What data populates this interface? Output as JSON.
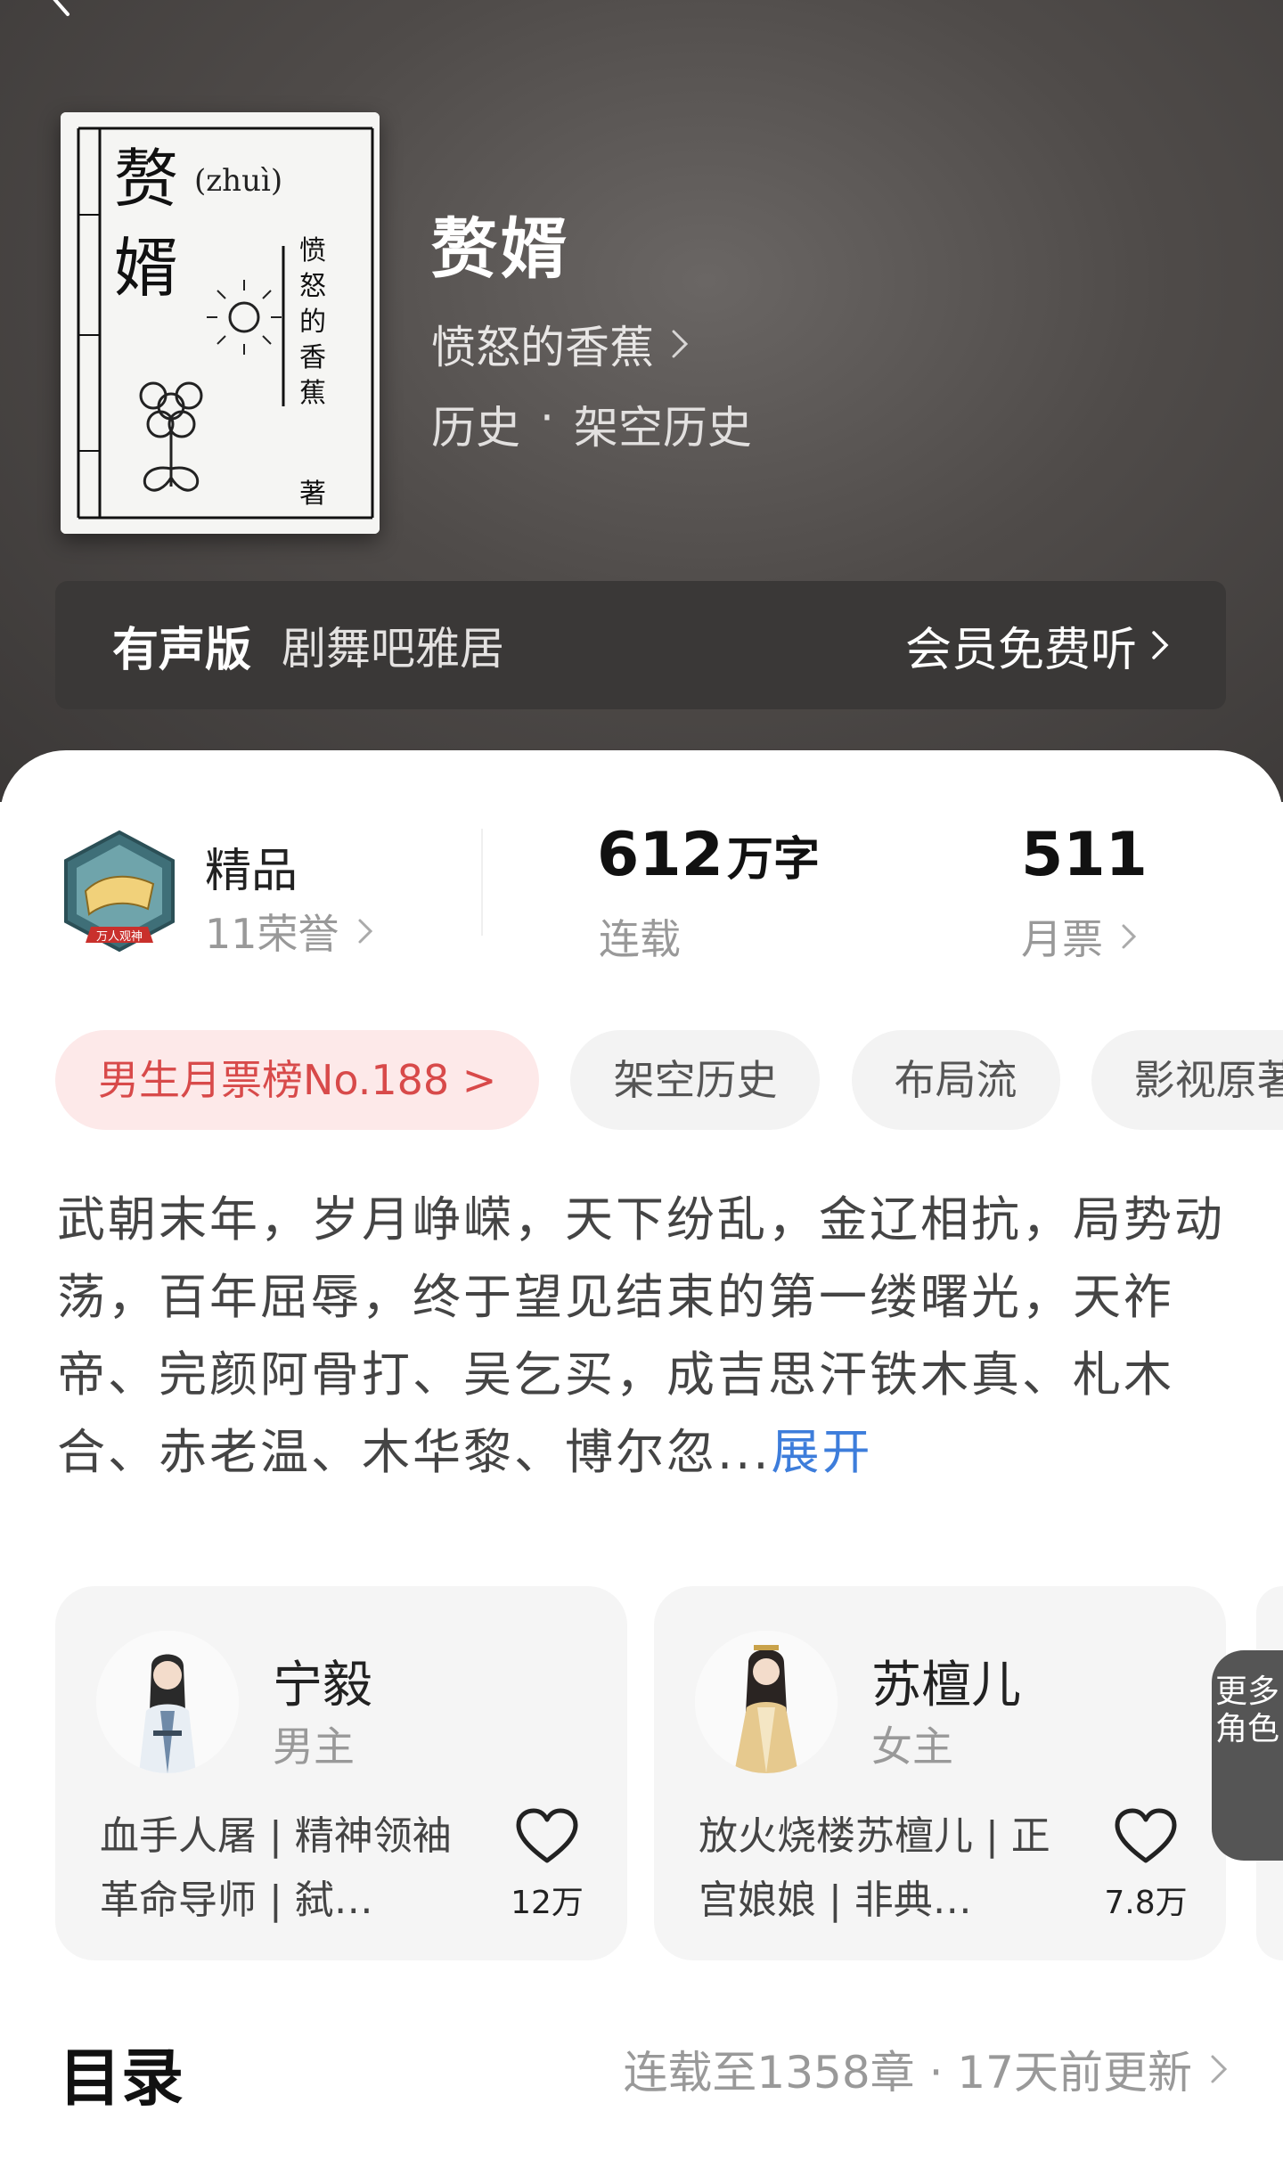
{
  "book": {
    "title": "赘婿",
    "author": "愤怒的香蕉",
    "category": "历史",
    "subcategory": "架空历史",
    "genre_dot": "·"
  },
  "cover": {
    "title_char1": "赘",
    "title_char2": "婿",
    "pinyin": "(zhuì)",
    "author_vertical": [
      "愤",
      "怒",
      "的",
      "香",
      "蕉"
    ],
    "author_suffix": "著"
  },
  "audio": {
    "label": "有声版",
    "narrator": "剧舞吧雅居",
    "action": "会员免费听"
  },
  "stats": {
    "badge_text": "万人观神",
    "level": "精品",
    "honors": "11荣誉",
    "word_count": "612",
    "word_unit": "万字",
    "status": "连载",
    "monthly_tickets": "511",
    "monthly_label": "月票"
  },
  "tags": [
    "男生月票榜No.188 >",
    "架空历史",
    "布局流",
    "影视原著"
  ],
  "synopsis": {
    "text": "武朝末年，岁月峥嵘，天下纷乱，金辽相抗，局势动荡，百年屈辱，终于望见结束的第一缕曙光，天祚帝、完颜阿骨打、吴乞买，成吉思汗铁木真、札木合、赤老温、木华黎、博尔忽...",
    "expand": "展开"
  },
  "characters": [
    {
      "name": "宁毅",
      "role": "男主",
      "desc": "血手人屠 | 精神领袖革命导师 | 弑…",
      "likes": "12万"
    },
    {
      "name": "苏檀儿",
      "role": "女主",
      "desc": "放火烧楼苏檀儿 | 正宫娘娘 | 非典…",
      "likes": "7.8万"
    }
  ],
  "more_roles": "更多角色",
  "toc": {
    "title": "目录",
    "info": "连载至1358章 · 17天前更新"
  },
  "colors": {
    "accent_blue": "#3d7ddb",
    "rank_red": "#d84a4a",
    "hero_bg": "#4f4b49"
  }
}
